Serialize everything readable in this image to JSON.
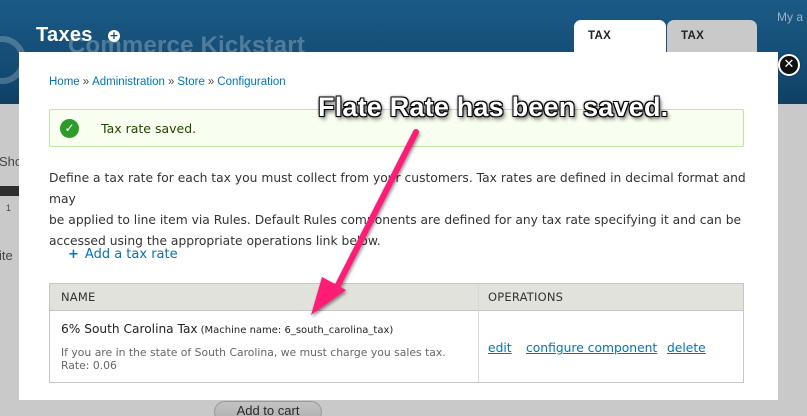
{
  "background": {
    "site_name": "Commerce Kickstart",
    "my_account": "My a",
    "sidebar_fragment_1": "Sho",
    "sidebar_fragment_2": "1",
    "sidebar_fragment_3": "ite",
    "cart_button": "Add to cart"
  },
  "overlay": {
    "title": "Taxes",
    "shortcut_icon": "plus-circle-icon",
    "close_icon": "close-icon",
    "tabs": [
      {
        "label": "TAX RATES",
        "active": true
      },
      {
        "label": "TAX TYPES",
        "active": false
      }
    ]
  },
  "breadcrumb": {
    "items": [
      "Home",
      "Administration",
      "Store",
      "Configuration"
    ],
    "separator": "»"
  },
  "status_message": {
    "icon": "check-circle-icon",
    "text": "Tax rate saved."
  },
  "description": {
    "line1": "Define a tax rate for each tax you must collect from your customers. Tax rates are defined in decimal format and may",
    "line2": "be applied to line item via Rules. Default Rules components are defined for any tax rate specifying it and can be",
    "line3": "accessed using the appropriate operations link below."
  },
  "add_link": {
    "icon": "plus-icon",
    "label": "Add a tax rate"
  },
  "table": {
    "headers": {
      "name": "NAME",
      "operations": "OPERATIONS"
    },
    "rows": [
      {
        "name": "6% South Carolina Tax",
        "machine_name": "(Machine name: 6_south_carolina_tax)",
        "description": "If you are in the state of South Carolina, we must charge you sales tax.",
        "rate": "Rate: 0.06",
        "operations": [
          "edit",
          "configure component",
          "delete"
        ]
      }
    ]
  },
  "annotation": {
    "text": "Flate Rate has been saved.",
    "arrow_color": "#ff1d74"
  },
  "colors": {
    "header_blue": "#134a72",
    "link_blue": "#0074bd",
    "success_green": "#2e9a2a"
  }
}
